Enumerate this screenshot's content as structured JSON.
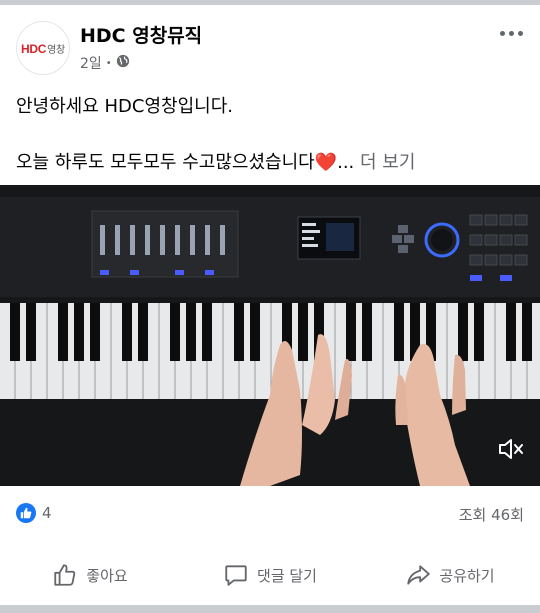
{
  "post": {
    "page_name": "HDC 영창뮤직",
    "avatar_logo": "HDC",
    "avatar_logo_sub": "영창",
    "timestamp": "2일",
    "audience_icon": "globe-icon",
    "more_icon": "more-horizontal-icon",
    "line1": "안녕하세요 HDC영창입니다.",
    "line2": "오늘 하루도 모두모두 수고많으셨습니다",
    "heart": "❤️",
    "ellipsis": "...",
    "see_more": "더 보기"
  },
  "video": {
    "mute_icon": "speaker-muted-icon"
  },
  "stats": {
    "like_icon": "thumbs-up-icon",
    "like_count": "4",
    "views": "조회 46회"
  },
  "actions": {
    "like_label": "좋아요",
    "comment_label": "댓글 달기",
    "share_label": "공유하기"
  },
  "colors": {
    "accent": "#1877f2",
    "secondary_text": "#65676b",
    "logo_red": "#d4252a"
  }
}
